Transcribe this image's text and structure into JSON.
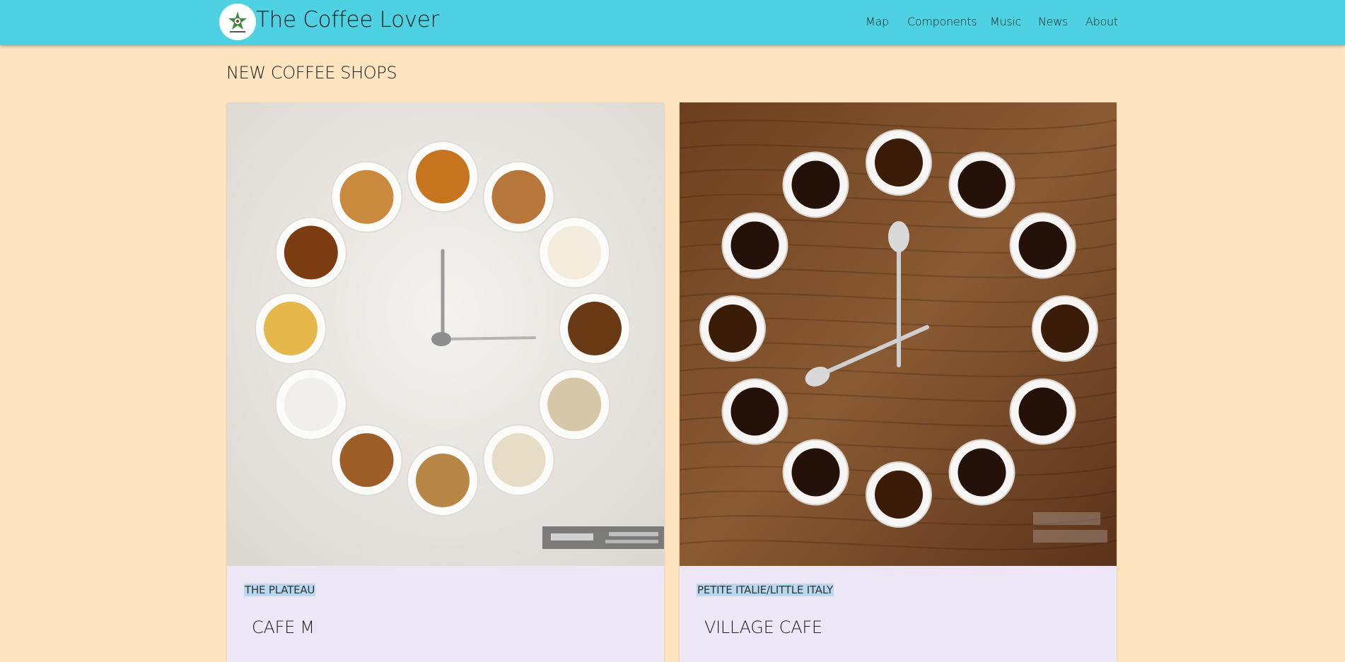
{
  "header": {
    "brand_title": "The Coffee Lover",
    "logo_icon": "coffee-flower-logo-icon",
    "nav": [
      {
        "label": "Map"
      },
      {
        "label": "Components"
      },
      {
        "label": "Music"
      },
      {
        "label": "News"
      },
      {
        "label": "About"
      }
    ]
  },
  "main": {
    "section_heading": "NEW COFFEE SHOPS",
    "cards": [
      {
        "neighborhood": "THE PLATEAU",
        "title": "CAFE M",
        "image": "coffee-cup-clock-light-photo"
      },
      {
        "neighborhood": "PETITE ITALIE/LITTLE ITALY",
        "title": "VILLAGE CAFE",
        "image": "coffee-cup-clock-wood-photo"
      }
    ]
  },
  "colors": {
    "navbar": "#4dd1e3",
    "page_background": "#ffe4c0",
    "card_background": "#ede6f6",
    "text_highlight": "#b9d8ee"
  }
}
